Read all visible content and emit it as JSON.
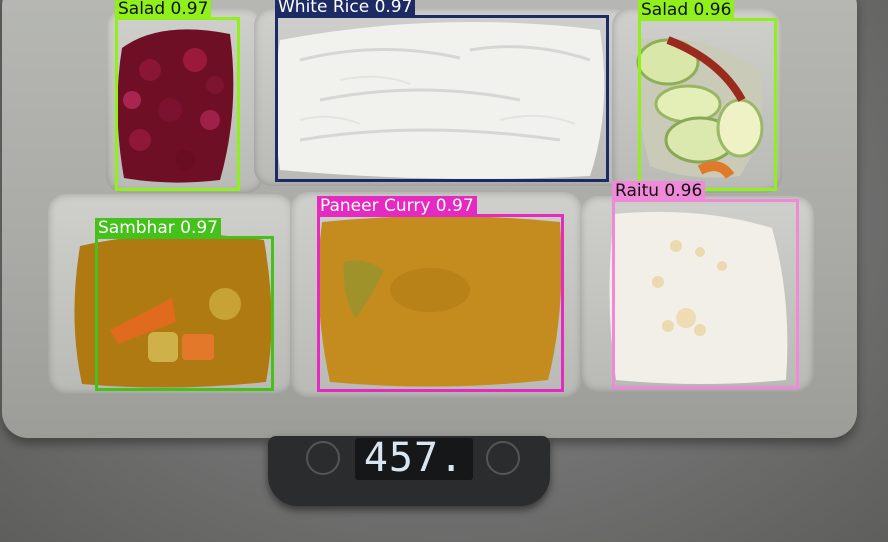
{
  "scale": {
    "reading": "457."
  },
  "detections": [
    {
      "label": "Salad 0.97",
      "color": "#8ff01c",
      "text_color": "#111111"
    },
    {
      "label": "White Rice 0.97",
      "color": "#1c2b66",
      "text_color": "#ffffff"
    },
    {
      "label": "Salad 0.96",
      "color": "#8ff01c",
      "text_color": "#111111"
    },
    {
      "label": "Sambhar 0.97",
      "color": "#45c11c",
      "text_color": "#ffffff"
    },
    {
      "label": "Paneer Curry 0.97",
      "color": "#e52ac2",
      "text_color": "#ffffff"
    },
    {
      "label": "Raitu 0.96",
      "color": "#f08ad8",
      "text_color": "#111111"
    }
  ]
}
